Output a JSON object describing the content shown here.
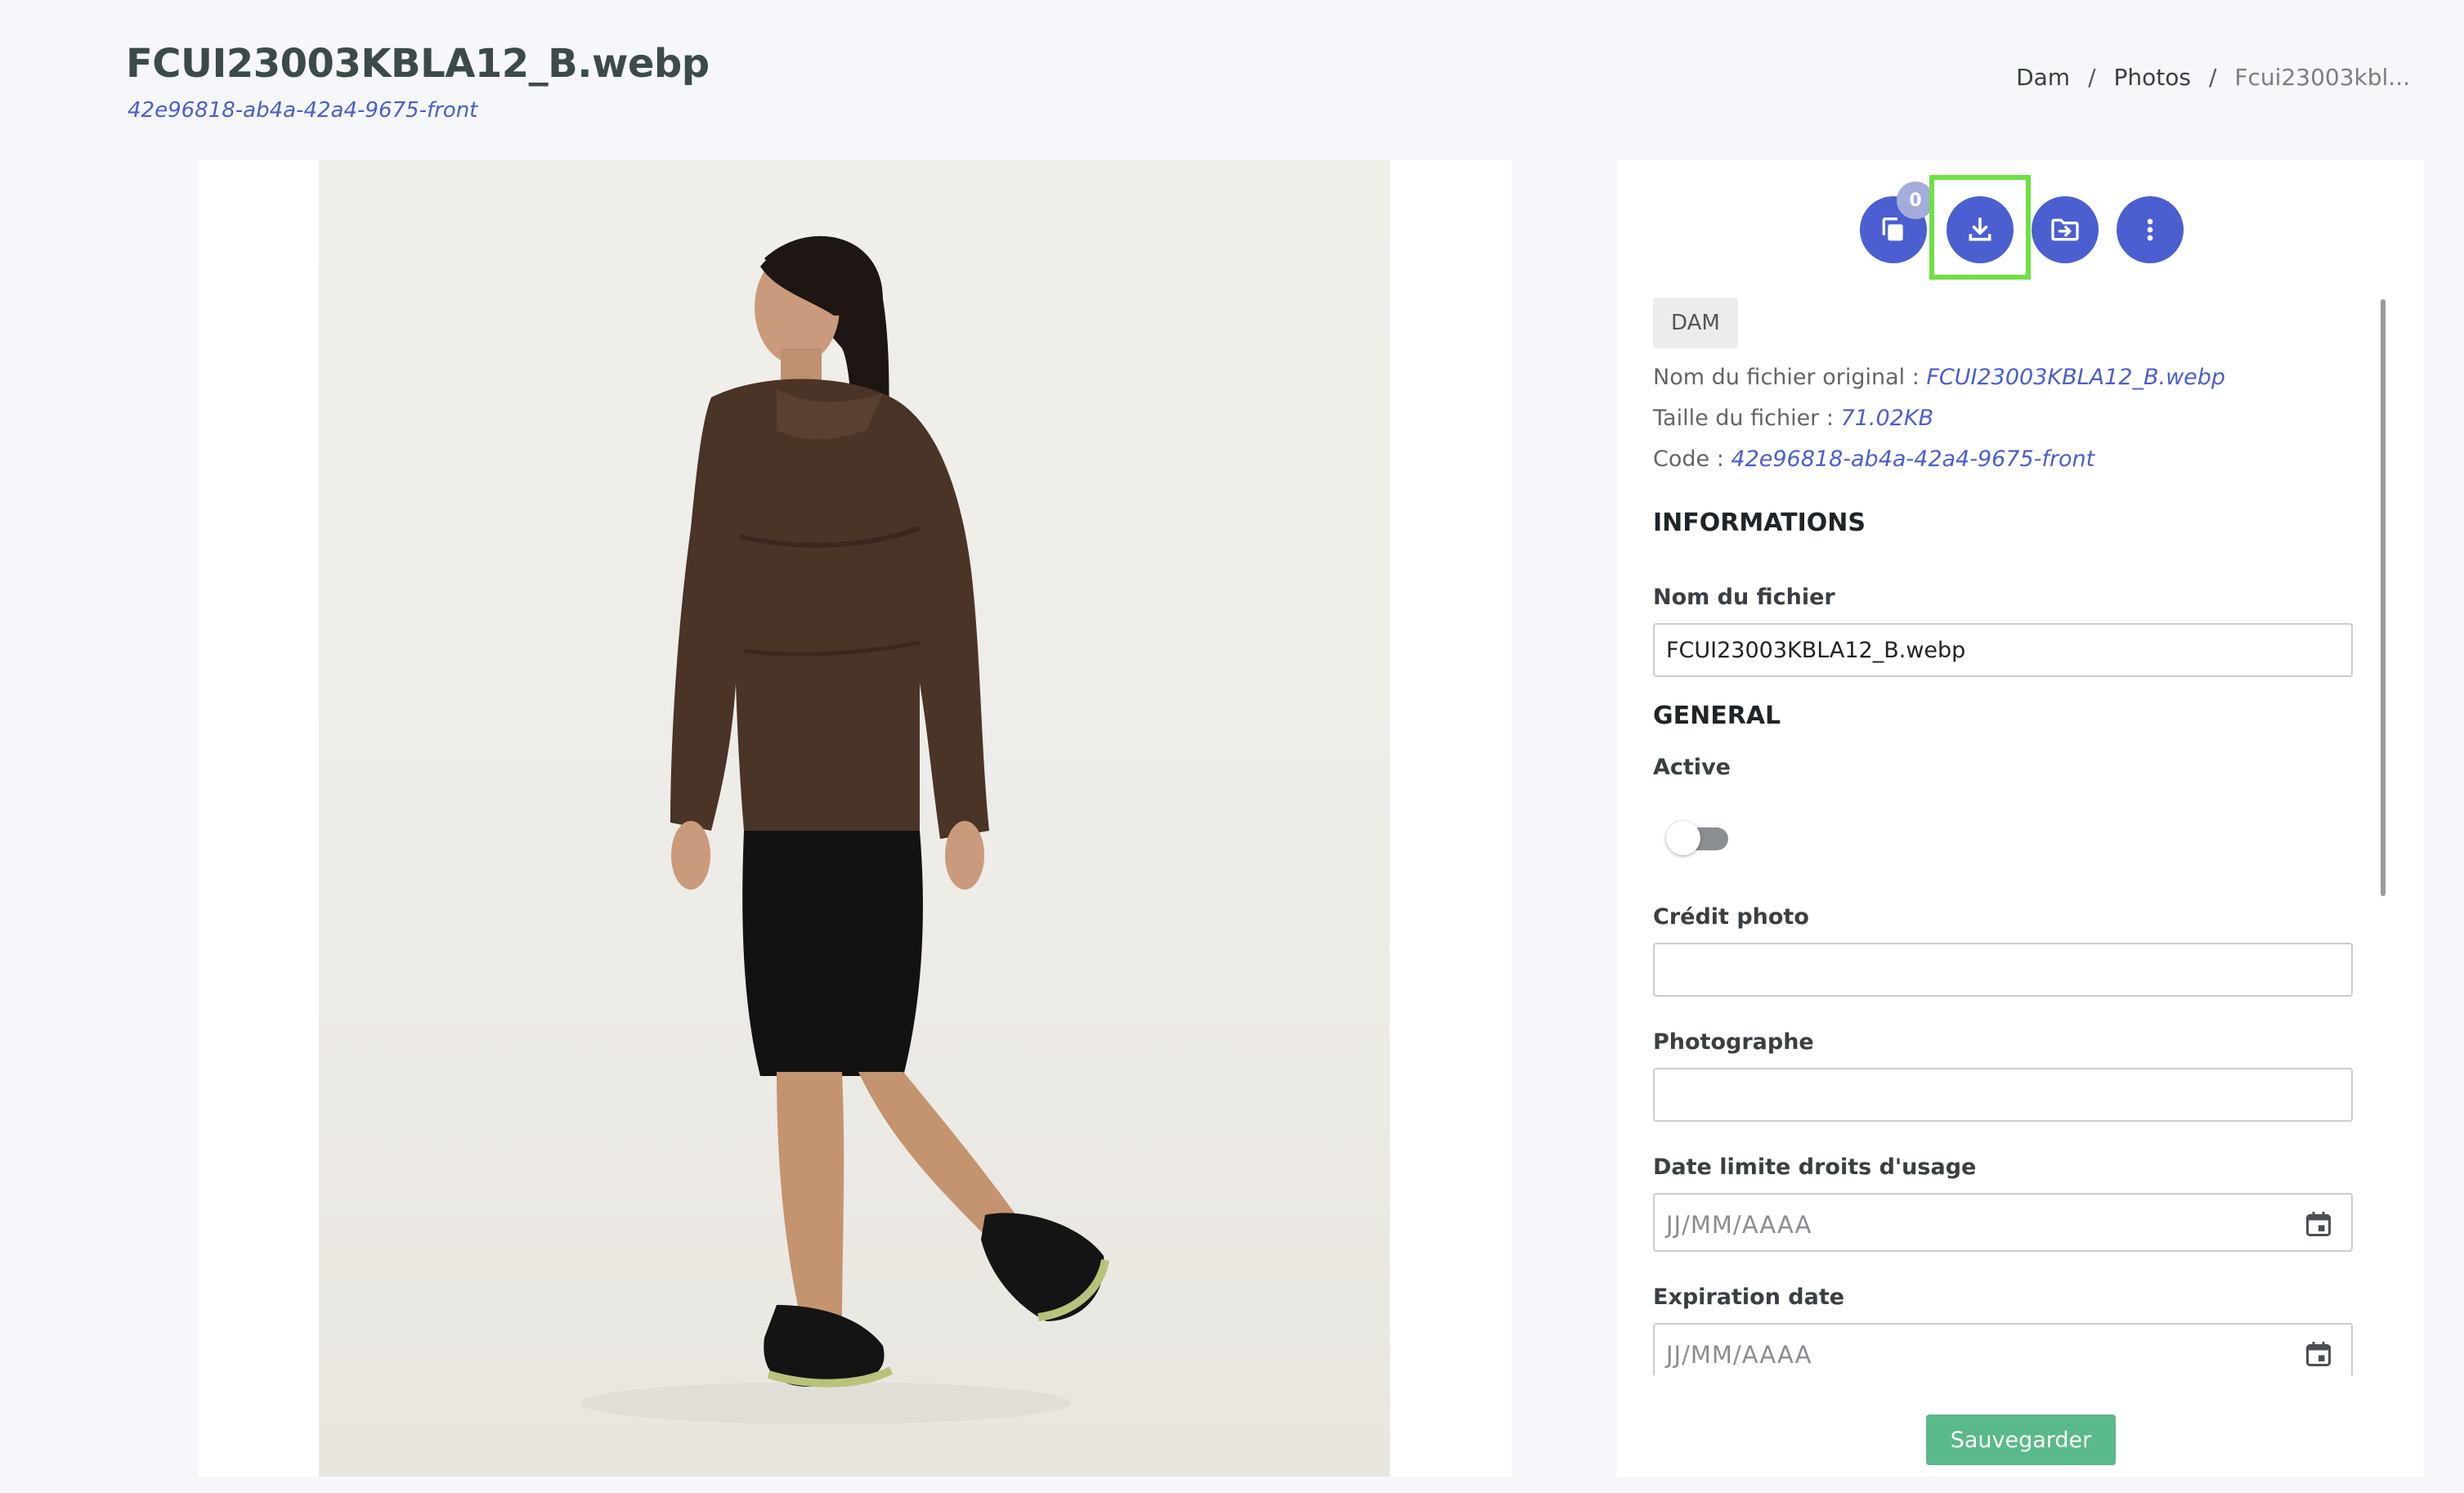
{
  "header": {
    "title": "FCUI23003KBLA12_B.webp",
    "subtitle": "42e96818-ab4a-42a4-9675-front",
    "breadcrumb": [
      "Dam",
      "Photos",
      "Fcui23003kbl..."
    ],
    "breadcrumb_separator": "/"
  },
  "actions": {
    "selection_count": "0",
    "icons": [
      "copy-icon",
      "download-icon",
      "move-to-folder-icon",
      "more-vertical-icon"
    ],
    "accent_color": "#4c5fd0",
    "highlight_color": "#6ee044"
  },
  "details": {
    "tag": "DAM",
    "original_name_label": "Nom du fichier original :",
    "original_name_value": "FCUI23003KBLA12_B.webp",
    "size_label": "Taille du fichier :",
    "size_value": "71.02KB",
    "code_label": "Code :",
    "code_value": "42e96818-ab4a-42a4-9675-front"
  },
  "informations": {
    "title": "INFORMATIONS",
    "file_name_label": "Nom du fichier",
    "file_name_value": "FCUI23003KBLA12_B.webp"
  },
  "general": {
    "title": "GENERAL",
    "active_label": "Active",
    "active": false,
    "credit_label": "Crédit photo",
    "credit_value": "",
    "photographer_label": "Photographe",
    "photographer_value": "",
    "usage_date_label": "Date limite droits d'usage",
    "date_placeholder": "JJ/MM/AAAA",
    "expiration_label": "Expiration date"
  },
  "footer": {
    "save_label": "Sauvegarder",
    "save_color": "#5ab98a"
  }
}
